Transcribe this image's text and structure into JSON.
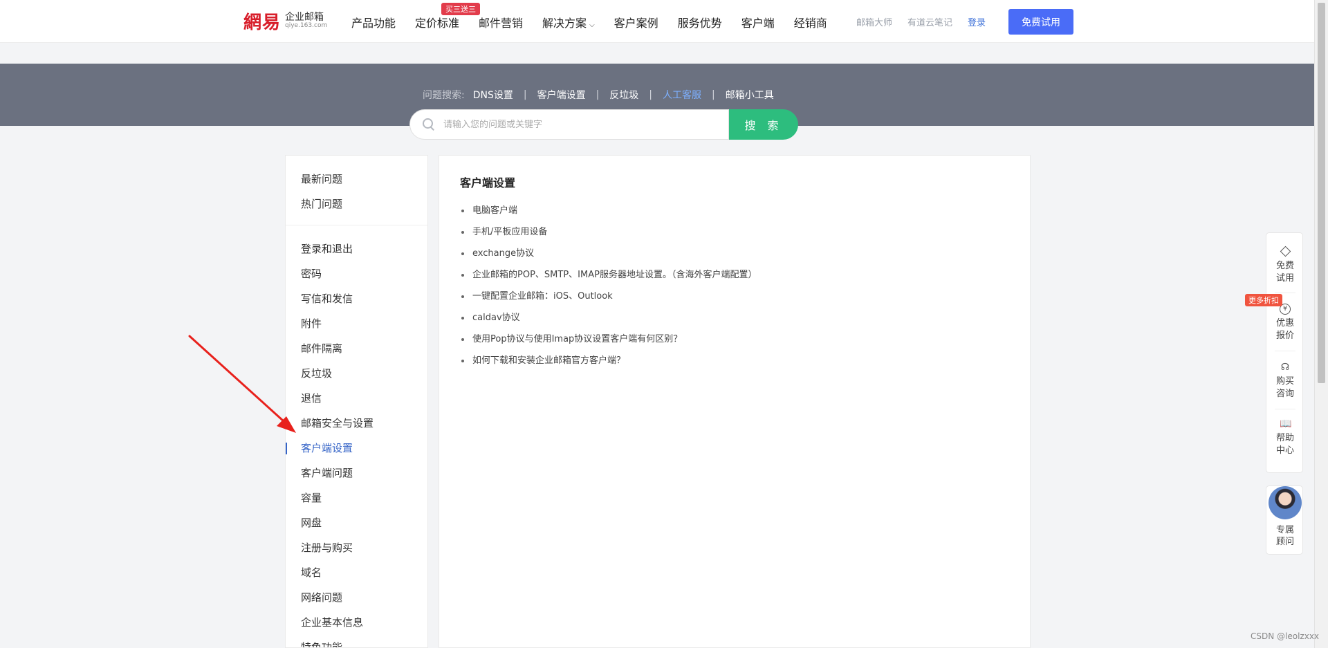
{
  "header": {
    "logo_mark": "網易",
    "logo_title": "企业邮箱",
    "logo_domain": "qiye.163.com",
    "nav": [
      {
        "label": "产品功能"
      },
      {
        "label": "定价标准"
      },
      {
        "label": "邮件营销"
      },
      {
        "label": "解决方案",
        "caret": "⌵"
      },
      {
        "label": "客户案例"
      },
      {
        "label": "服务优势"
      },
      {
        "label": "客户端"
      },
      {
        "label": "经销商"
      }
    ],
    "promo_badge": "买三送三",
    "links": [
      "邮箱大师",
      "有道云笔记"
    ],
    "login": "登录",
    "trial_button": "免费试用"
  },
  "banner": {
    "quick_label": "问题搜索:",
    "quick_items": [
      "DNS设置",
      "客户端设置",
      "反垃圾",
      "人工客服",
      "邮箱小工具"
    ],
    "active_quick_item": "人工客服",
    "search_placeholder": "请输入您的问题或关键字",
    "search_button": "搜 索"
  },
  "sidebar": {
    "group1": [
      "最新问题",
      "热门问题"
    ],
    "group2": [
      "登录和退出",
      "密码",
      "写信和发信",
      "附件",
      "邮件隔离",
      "反垃圾",
      "退信",
      "邮箱安全与设置",
      "客户端设置",
      "客户端问题",
      "容量",
      "网盘",
      "注册与购买",
      "域名",
      "网络问题",
      "企业基本信息",
      "特色功能"
    ],
    "active_item": "客户端设置"
  },
  "content": {
    "title": "客户端设置",
    "items": [
      "电脑客户端",
      "手机/平板应用设备",
      "exchange协议",
      "企业邮箱的POP、SMTP、IMAP服务器地址设置。（含海外客户端配置）",
      "一键配置企业邮箱：iOS、Outlook",
      "caldav协议",
      "使用Pop协议与使用Imap协议设置客户端有何区别？",
      "如何下载和安装企业邮箱官方客户端？"
    ]
  },
  "float_panel": {
    "items": [
      {
        "icon": "diamond-icon",
        "line1": "免费",
        "line2": "试用"
      },
      {
        "icon": "yen-icon",
        "glyph": "¥",
        "line1": "优惠",
        "line2": "报价"
      },
      {
        "icon": "headset-icon",
        "glyph": "☊",
        "line1": "购买",
        "line2": "咨询"
      },
      {
        "icon": "book-icon",
        "glyph": "📖",
        "line1": "帮助",
        "line2": "中心"
      }
    ],
    "discount_badge": "更多折扣",
    "advisor_line1": "专属",
    "advisor_line2": "顾问"
  },
  "watermark": "CSDN @leolzxxx",
  "colors": {
    "brand_red": "#d81e2a",
    "trial_blue": "#4a6cf7",
    "search_green": "#2dbd7e",
    "active_link": "#3564c7",
    "arrow_red": "#e8211c"
  }
}
